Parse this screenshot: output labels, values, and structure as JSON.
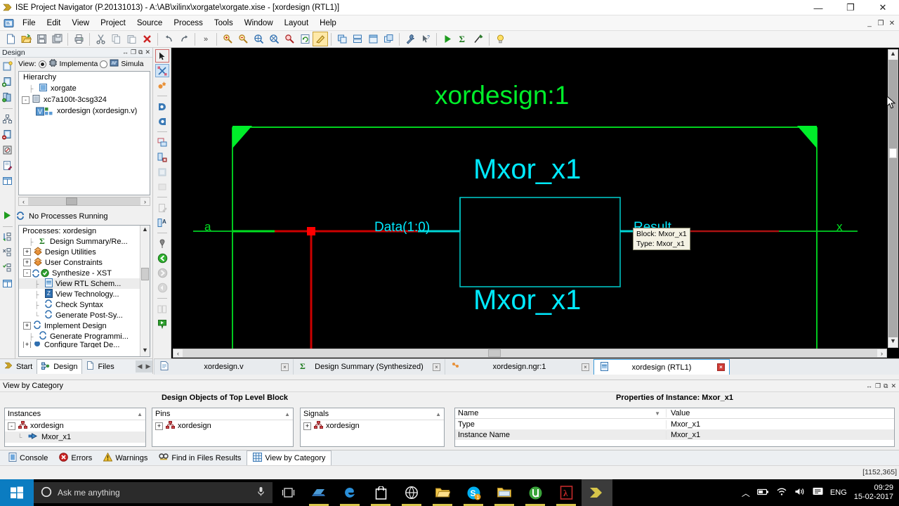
{
  "window": {
    "title": "ISE Project Navigator (P.20131013) - A:\\AB\\xilinx\\xorgate\\xorgate.xise - [xordesign (RTL1)]",
    "minimize": "—",
    "maximize": "❐",
    "close": "✕",
    "mdi_minimize": "_",
    "mdi_restore": "❐",
    "mdi_close": "✕"
  },
  "menu": {
    "items": [
      "File",
      "Edit",
      "View",
      "Project",
      "Source",
      "Process",
      "Tools",
      "Window",
      "Layout",
      "Help"
    ]
  },
  "toolbar": {
    "groups": [
      [
        "new-file-icon",
        "open-file-icon",
        "save-icon",
        "save-all-icon"
      ],
      [
        "print-icon"
      ],
      [
        "cut-icon",
        "copy-icon",
        "paste-icon",
        "delete-icon"
      ],
      [
        "undo-icon",
        "redo-icon"
      ],
      [
        "overflow-chevron-icon"
      ],
      [
        "zoom-in-icon",
        "zoom-out-icon",
        "zoom-fit-icon",
        "zoom-selection-icon",
        "zoom-area-icon",
        "refresh-icon",
        "highlight-icon"
      ],
      [
        "tile-horizontal-icon",
        "tile-vertical-icon",
        "single-pane-icon",
        "cascade-icon"
      ],
      [
        "settings-wrench-icon",
        "context-help-icon"
      ],
      [
        "run-icon",
        "sum-icon",
        "pin-icon"
      ],
      [
        "idea-bulb-icon"
      ]
    ]
  },
  "design_panel": {
    "title": "Design",
    "tools": [
      "↔",
      "❐",
      "⧉",
      "✕"
    ],
    "view_label": "View:",
    "view_options": [
      {
        "label": "Implementa",
        "icon": "chip-icon",
        "selected": true
      },
      {
        "label": "Simula",
        "icon": "waveform-icon",
        "selected": false
      }
    ],
    "hierarchy_label": "Hierarchy",
    "tree": [
      {
        "label": "xorgate",
        "icon": "project-icon",
        "indent": 1,
        "expander": ""
      },
      {
        "label": "xc7a100t-3csg324",
        "icon": "device-icon",
        "indent": 1,
        "expander": "-"
      },
      {
        "label": "xordesign (xordesign.v)",
        "icon": "verilog-module-icon",
        "indent": 2,
        "expander": "",
        "selected": true
      }
    ],
    "side_icons": [
      "new-source-icon",
      "add-source-icon",
      "add-copy-source-icon",
      "view-hierarchy-icon",
      "remove-source-icon",
      "manual-compile-icon",
      "edit-constraints-icon",
      "design-summary-icon"
    ]
  },
  "process_panel": {
    "status": "No Processes Running",
    "status_icon": "refresh-circular-icon",
    "header": "Processes: xordesign",
    "side_icons": [
      "run-green-icon",
      "implement-top-icon",
      "rerun-icon",
      "rerun-all-icon",
      "design-goals-icon"
    ],
    "items": [
      {
        "label": "Design Summary/Re...",
        "indent": 1,
        "expander": "",
        "icon": "sigma-icon",
        "selected": false
      },
      {
        "label": "Design Utilities",
        "indent": 1,
        "expander": "+",
        "icon": "utilities-icon",
        "selected": false
      },
      {
        "label": "User Constraints",
        "indent": 1,
        "expander": "+",
        "icon": "constraints-icon",
        "selected": false
      },
      {
        "label": "Synthesize - XST",
        "indent": 1,
        "expander": "-",
        "icon": "process-check-icon",
        "selected": false
      },
      {
        "label": "View RTL Schem...",
        "indent": 3,
        "expander": "",
        "icon": "rtl-schematic-icon",
        "selected": true
      },
      {
        "label": "View Technology...",
        "indent": 3,
        "expander": "",
        "icon": "tech-schematic-icon",
        "selected": false
      },
      {
        "label": "Check Syntax",
        "indent": 3,
        "expander": "",
        "icon": "process-icon",
        "selected": false
      },
      {
        "label": "Generate Post-Sy...",
        "indent": 3,
        "expander": "",
        "icon": "process-icon",
        "selected": false
      },
      {
        "label": "Implement Design",
        "indent": 1,
        "expander": "+",
        "icon": "process-icon",
        "selected": false
      },
      {
        "label": "Generate Programmi...",
        "indent": 1,
        "expander": "",
        "icon": "process-icon",
        "selected": false
      },
      {
        "label": "Configure Target De...",
        "indent": 1,
        "expander": "+",
        "icon": "configure-icon",
        "selected": false
      }
    ]
  },
  "left_tabs": {
    "tabs": [
      {
        "label": "Start",
        "icon": "start-arrow-icon",
        "active": false
      },
      {
        "label": "Design",
        "icon": "design-icon",
        "active": true
      },
      {
        "label": "Files",
        "icon": "files-icon",
        "active": false
      }
    ],
    "scroll_left": "◀",
    "scroll_right": "▶"
  },
  "schematic_tools": {
    "icons": [
      "select-pointer-icon",
      "toggle-hierarchy-icon",
      "add-sheet-icon",
      "zoom-in-schematic-icon",
      "zoom-out-schematic-icon",
      "new-window-icon",
      "delete-window-icon",
      "float-icon",
      "dock-icon",
      "rename-icon",
      "find-text-icon",
      "pin-marker-icon",
      "back-green-icon",
      "forward-icon",
      "rewind-icon",
      "split-pane-icon",
      "bookmark-green-icon"
    ]
  },
  "schematic": {
    "sheet_title": "xordesign:1",
    "block_title_top": "Mxor_x1",
    "block_title_bottom": "Mxor_x1",
    "input_port": "a",
    "output_port": "x",
    "bus_label": "Data(1:0)",
    "result_label": "Result",
    "colors": {
      "background": "#000000",
      "sheet_border": "#00d21e",
      "block_outline": "#00d6d6",
      "bus_wire": "#00d6d6",
      "net_wire": "#cc0000",
      "port_wire": "#00c800",
      "title_text": "#00ee2a",
      "block_text": "#00eaff"
    },
    "tooltip": {
      "line1": "Block: Mxor_x1",
      "line2": "Type: Mxor_x1"
    },
    "scrollbars": {
      "v_up": "▲",
      "v_down": "▼",
      "h_left": "◀",
      "h_right": "▶"
    }
  },
  "doc_tabs": {
    "tabs": [
      {
        "label": "xordesign.v",
        "icon": "verilog-file-icon",
        "close": "×",
        "active": false
      },
      {
        "label": "Design Summary (Synthesized)",
        "icon": "sigma-icon",
        "close": "×",
        "active": false
      },
      {
        "label": "xordesign.ngr:1",
        "icon": "ngr-file-icon",
        "close": "×",
        "active": false
      },
      {
        "label": "xordesign (RTL1)",
        "icon": "rtl-schematic-icon",
        "close": "×",
        "active": true
      }
    ]
  },
  "view_by_category": {
    "label": "View by Category",
    "tools": [
      "↔",
      "❐",
      "⧉",
      "✕"
    ]
  },
  "design_objects": {
    "title": "Design Objects of Top Level Block",
    "columns": [
      {
        "header": "Instances",
        "sort_arrow": "▲",
        "items": [
          {
            "label": "xordesign",
            "icon": "hierarchy-red-icon",
            "expander": "-",
            "indent": 0,
            "selected": false
          },
          {
            "label": "Mxor_x1",
            "icon": "instance-blue-icon",
            "expander": "",
            "indent": 1,
            "selected": true
          }
        ]
      },
      {
        "header": "Pins",
        "sort_arrow": "▲",
        "items": [
          {
            "label": "xordesign",
            "icon": "hierarchy-red-icon",
            "expander": "+",
            "indent": 0,
            "selected": false
          }
        ]
      },
      {
        "header": "Signals",
        "sort_arrow": "▲",
        "items": [
          {
            "label": "xordesign",
            "icon": "hierarchy-red-icon",
            "expander": "+",
            "indent": 0,
            "selected": false
          }
        ]
      }
    ]
  },
  "properties": {
    "title": "Properties of Instance: Mxor_x1",
    "columns": [
      "Name",
      "Value"
    ],
    "sort_arrow": "▼",
    "rows": [
      {
        "name": "Type",
        "value": "Mxor_x1",
        "selected": false
      },
      {
        "name": "Instance Name",
        "value": "Mxor_x1",
        "selected": true
      }
    ]
  },
  "console_tabs": {
    "tabs": [
      {
        "label": "Console",
        "icon": "console-icon",
        "active": false
      },
      {
        "label": "Errors",
        "icon": "error-icon",
        "active": false
      },
      {
        "label": "Warnings",
        "icon": "warning-icon",
        "active": false
      },
      {
        "label": "Find in Files Results",
        "icon": "find-files-icon",
        "active": false
      },
      {
        "label": "View by Category",
        "icon": "grid-icon",
        "active": true
      }
    ]
  },
  "status_bar": {
    "coordinates": "[1152,365]"
  },
  "taskbar": {
    "start_icon": "windows-logo-icon",
    "search_placeholder": "Ask me anything",
    "search_icon": "cortana-circle-icon",
    "mic_icon": "microphone-icon",
    "apps": [
      {
        "name": "task-view-icon",
        "running": false,
        "active": false
      },
      {
        "name": "file-transfer-icon",
        "running": true,
        "active": false
      },
      {
        "name": "edge-icon",
        "running": true,
        "active": false
      },
      {
        "name": "store-icon",
        "running": true,
        "active": false
      },
      {
        "name": "browser-icon",
        "running": true,
        "active": false
      },
      {
        "name": "folder-yellow-icon",
        "running": true,
        "active": false
      },
      {
        "name": "skype-icon",
        "running": true,
        "active": false,
        "badge": "1"
      },
      {
        "name": "file-explorer-icon",
        "running": true,
        "active": false
      },
      {
        "name": "utorrent-icon",
        "running": true,
        "active": false
      },
      {
        "name": "adobe-reader-icon",
        "running": true,
        "active": false
      },
      {
        "name": "ise-navigator-icon",
        "running": true,
        "active": true
      }
    ],
    "tray": {
      "chevron": "︿",
      "icons": [
        "battery-icon",
        "wifi-icon",
        "volume-icon",
        "action-center-icon"
      ],
      "language": "ENG",
      "time": "09:29",
      "date": "15-02-2017"
    }
  }
}
